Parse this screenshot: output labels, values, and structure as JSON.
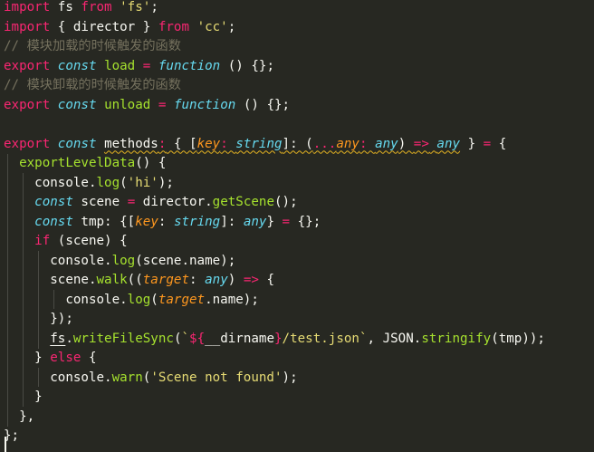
{
  "editor": {
    "lines": [
      {
        "tokens": [
          {
            "t": "import",
            "c": "kw"
          },
          {
            "t": " fs ",
            "c": ""
          },
          {
            "t": "from",
            "c": "kw"
          },
          {
            "t": " ",
            "c": ""
          },
          {
            "t": "'fs'",
            "c": "str"
          },
          {
            "t": ";",
            "c": ""
          }
        ]
      },
      {
        "tokens": [
          {
            "t": "import",
            "c": "kw"
          },
          {
            "t": " { director } ",
            "c": ""
          },
          {
            "t": "from",
            "c": "kw"
          },
          {
            "t": " ",
            "c": ""
          },
          {
            "t": "'cc'",
            "c": "str"
          },
          {
            "t": ";",
            "c": ""
          }
        ]
      },
      {
        "tokens": [
          {
            "t": "// 模块加载的时候触发的函数",
            "c": "cm"
          }
        ]
      },
      {
        "tokens": [
          {
            "t": "export",
            "c": "kw"
          },
          {
            "t": " ",
            "c": ""
          },
          {
            "t": "const",
            "c": "it"
          },
          {
            "t": " ",
            "c": ""
          },
          {
            "t": "load",
            "c": "fn"
          },
          {
            "t": " ",
            "c": ""
          },
          {
            "t": "=",
            "c": "kw"
          },
          {
            "t": " ",
            "c": ""
          },
          {
            "t": "function",
            "c": "it"
          },
          {
            "t": " () {};",
            "c": ""
          }
        ]
      },
      {
        "tokens": [
          {
            "t": "// 模块卸载的时候触发的函数",
            "c": "cm"
          }
        ]
      },
      {
        "tokens": [
          {
            "t": "export",
            "c": "kw"
          },
          {
            "t": " ",
            "c": ""
          },
          {
            "t": "const",
            "c": "it"
          },
          {
            "t": " ",
            "c": ""
          },
          {
            "t": "unload",
            "c": "fn"
          },
          {
            "t": " ",
            "c": ""
          },
          {
            "t": "=",
            "c": "kw"
          },
          {
            "t": " ",
            "c": ""
          },
          {
            "t": "function",
            "c": "it"
          },
          {
            "t": " () {};",
            "c": ""
          }
        ]
      },
      {
        "tokens": []
      },
      {
        "tokens": [
          {
            "t": "export",
            "c": "kw"
          },
          {
            "t": " ",
            "c": ""
          },
          {
            "t": "const",
            "c": "it"
          },
          {
            "t": " ",
            "c": ""
          },
          {
            "t": "methods",
            "c": "squig"
          },
          {
            "t": ":",
            "c": "kw squig"
          },
          {
            "t": " { [",
            "c": "squig"
          },
          {
            "t": "key",
            "c": "param squig"
          },
          {
            "t": ": ",
            "c": "kw squig"
          },
          {
            "t": "string",
            "c": "typ squig"
          },
          {
            "t": "]: (",
            "c": "squig"
          },
          {
            "t": "...",
            "c": "kw squig"
          },
          {
            "t": "any",
            "c": "param squig"
          },
          {
            "t": ": ",
            "c": "kw squig"
          },
          {
            "t": "any",
            "c": "typ squig"
          },
          {
            "t": ") ",
            "c": "squig"
          },
          {
            "t": "=>",
            "c": "kw squig"
          },
          {
            "t": " ",
            "c": "squig"
          },
          {
            "t": "any",
            "c": "typ squig"
          },
          {
            "t": " } ",
            "c": ""
          },
          {
            "t": "=",
            "c": "kw"
          },
          {
            "t": " {",
            "c": ""
          }
        ]
      },
      {
        "tokens": [
          {
            "t": "  ",
            "c": ""
          },
          {
            "t": "exportLevelData",
            "c": "fn"
          },
          {
            "t": "() {",
            "c": ""
          }
        ]
      },
      {
        "tokens": [
          {
            "t": "    console.",
            "c": ""
          },
          {
            "t": "log",
            "c": "fn"
          },
          {
            "t": "(",
            "c": ""
          },
          {
            "t": "'hi'",
            "c": "str"
          },
          {
            "t": ");",
            "c": ""
          }
        ]
      },
      {
        "tokens": [
          {
            "t": "    ",
            "c": ""
          },
          {
            "t": "const",
            "c": "it"
          },
          {
            "t": " scene ",
            "c": ""
          },
          {
            "t": "=",
            "c": "kw"
          },
          {
            "t": " director.",
            "c": ""
          },
          {
            "t": "getScene",
            "c": "fn"
          },
          {
            "t": "();",
            "c": ""
          }
        ]
      },
      {
        "tokens": [
          {
            "t": "    ",
            "c": ""
          },
          {
            "t": "const",
            "c": "it"
          },
          {
            "t": " tmp: {[",
            "c": ""
          },
          {
            "t": "key",
            "c": "param"
          },
          {
            "t": ": ",
            "c": ""
          },
          {
            "t": "string",
            "c": "typ"
          },
          {
            "t": "]: ",
            "c": ""
          },
          {
            "t": "any",
            "c": "typ"
          },
          {
            "t": "} ",
            "c": ""
          },
          {
            "t": "=",
            "c": "kw"
          },
          {
            "t": " {};",
            "c": ""
          }
        ]
      },
      {
        "tokens": [
          {
            "t": "    ",
            "c": ""
          },
          {
            "t": "if",
            "c": "kw"
          },
          {
            "t": " (scene) {",
            "c": ""
          }
        ]
      },
      {
        "tokens": [
          {
            "t": "      console.",
            "c": ""
          },
          {
            "t": "log",
            "c": "fn"
          },
          {
            "t": "(scene.name);",
            "c": ""
          }
        ]
      },
      {
        "tokens": [
          {
            "t": "      scene.",
            "c": ""
          },
          {
            "t": "walk",
            "c": "fn"
          },
          {
            "t": "((",
            "c": ""
          },
          {
            "t": "target",
            "c": "param"
          },
          {
            "t": ": ",
            "c": ""
          },
          {
            "t": "any",
            "c": "typ"
          },
          {
            "t": ") ",
            "c": ""
          },
          {
            "t": "=>",
            "c": "kw"
          },
          {
            "t": " {",
            "c": ""
          }
        ]
      },
      {
        "tokens": [
          {
            "t": "        console.",
            "c": ""
          },
          {
            "t": "log",
            "c": "fn"
          },
          {
            "t": "(",
            "c": ""
          },
          {
            "t": "target",
            "c": "param"
          },
          {
            "t": ".name);",
            "c": ""
          }
        ]
      },
      {
        "tokens": [
          {
            "t": "      });",
            "c": ""
          }
        ]
      },
      {
        "tokens": [
          {
            "t": "      ",
            "c": ""
          },
          {
            "t": "fs",
            "c": "uline"
          },
          {
            "t": ".",
            "c": ""
          },
          {
            "t": "writeFileSync",
            "c": "fn"
          },
          {
            "t": "(",
            "c": ""
          },
          {
            "t": "`",
            "c": "str"
          },
          {
            "t": "${",
            "c": "kw"
          },
          {
            "t": "__dirname",
            "c": ""
          },
          {
            "t": "}",
            "c": "kw"
          },
          {
            "t": "/test.json`",
            "c": "str"
          },
          {
            "t": ", JSON.",
            "c": ""
          },
          {
            "t": "stringify",
            "c": "fn"
          },
          {
            "t": "(tmp));",
            "c": ""
          }
        ]
      },
      {
        "tokens": [
          {
            "t": "    } ",
            "c": ""
          },
          {
            "t": "else",
            "c": "kw"
          },
          {
            "t": " {",
            "c": ""
          }
        ]
      },
      {
        "tokens": [
          {
            "t": "      console.",
            "c": ""
          },
          {
            "t": "warn",
            "c": "fn"
          },
          {
            "t": "(",
            "c": ""
          },
          {
            "t": "'Scene not found'",
            "c": "str"
          },
          {
            "t": ");",
            "c": ""
          }
        ]
      },
      {
        "tokens": [
          {
            "t": "    }",
            "c": ""
          }
        ]
      },
      {
        "tokens": [
          {
            "t": "  },",
            "c": ""
          }
        ]
      },
      {
        "tokens": [
          {
            "t": "};",
            "c": ""
          }
        ]
      }
    ]
  }
}
